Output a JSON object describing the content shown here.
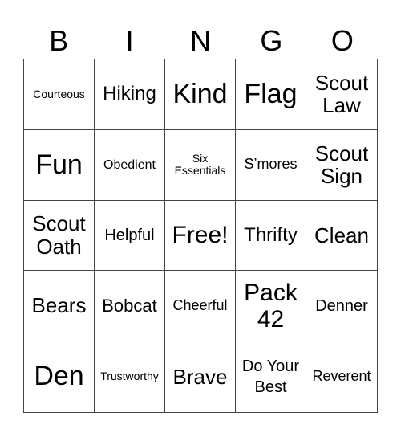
{
  "header": [
    "B",
    "I",
    "N",
    "G",
    "O"
  ],
  "cells": [
    "Courteous",
    "Hiking",
    "Kind",
    "Flag",
    "Scout Law",
    "Fun",
    "Obedient",
    "Six Essentials",
    "S’mores",
    "Scout Sign",
    "Scout Oath",
    "Helpful",
    "Free!",
    "Thrifty",
    "Clean",
    "Bears",
    "Bobcat",
    "Cheerful",
    "Pack 42",
    "Denner",
    "Den",
    "Trustworthy",
    "Brave",
    "Do Your Best",
    "Reverent"
  ]
}
